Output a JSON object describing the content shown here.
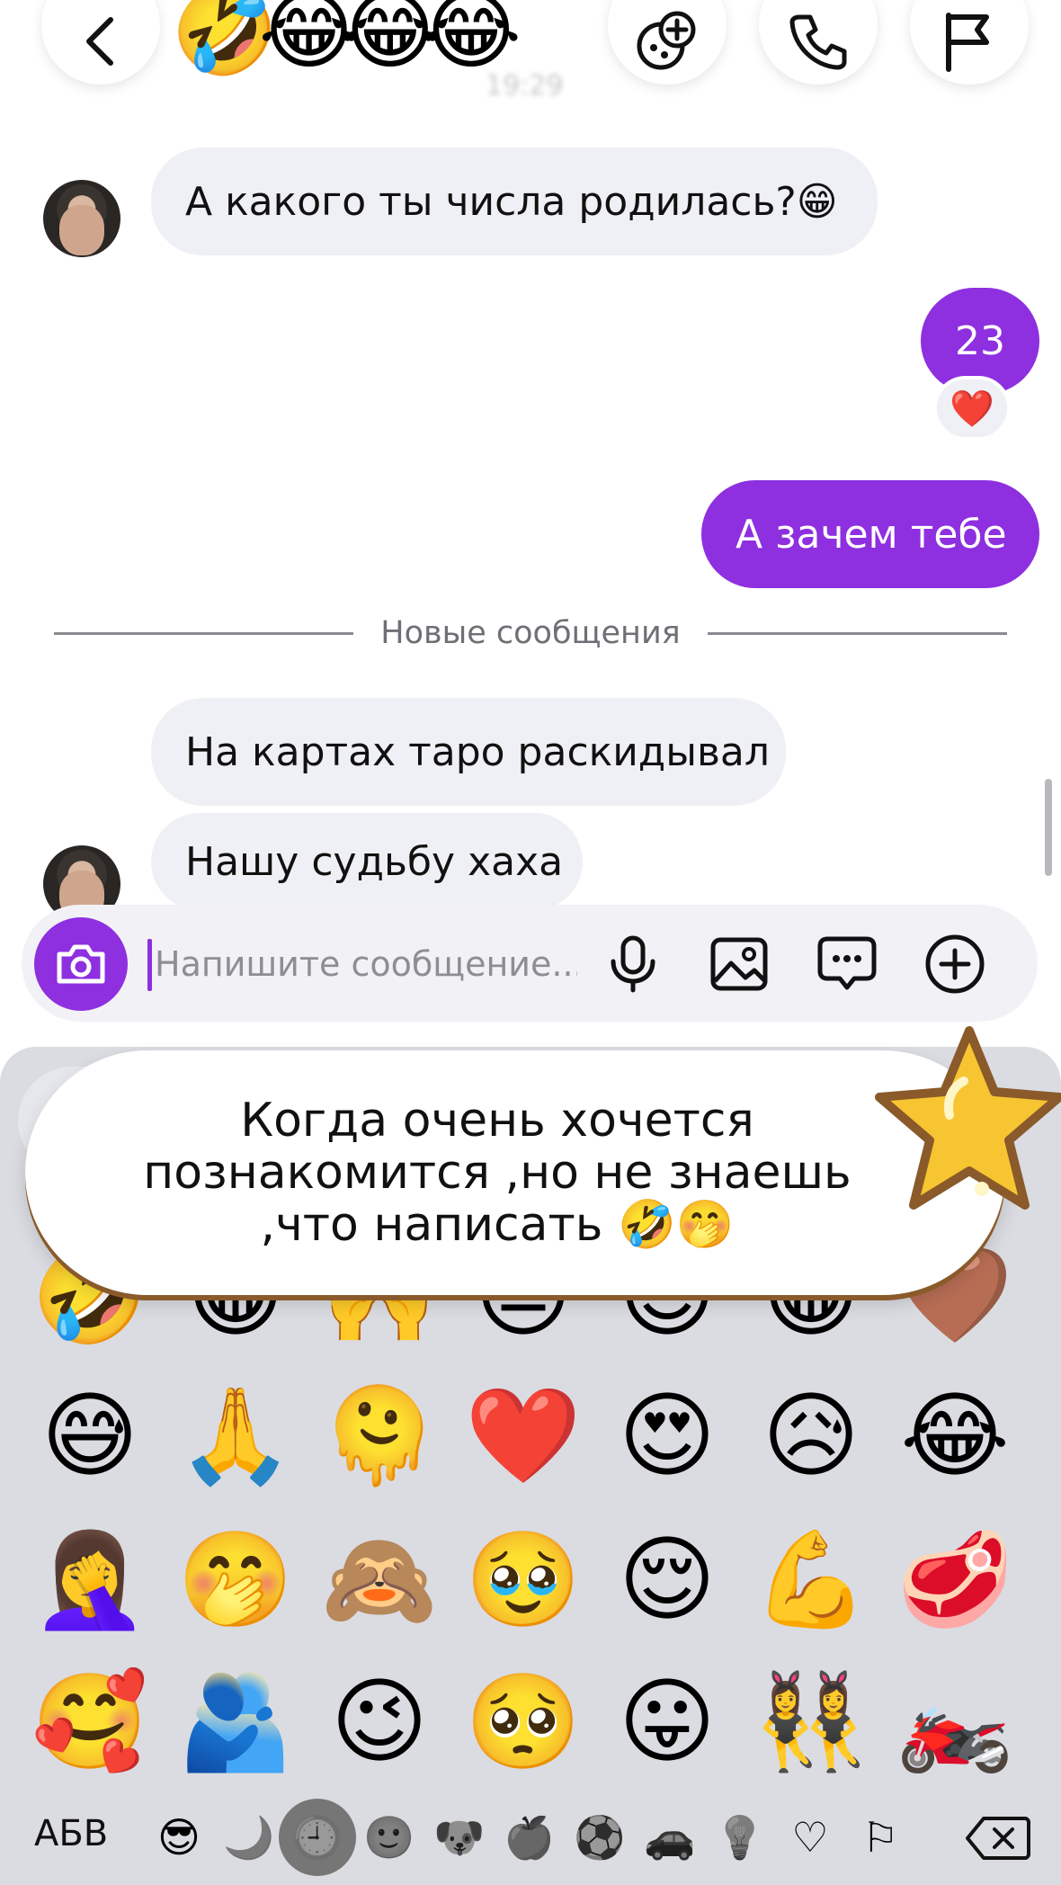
{
  "header": {
    "title_emojis": "🤣😂😂😂",
    "time": "19:29"
  },
  "messages": [
    {
      "dir": "in",
      "text": "А какого ты числа родилась?😁"
    },
    {
      "dir": "out",
      "text": "23",
      "reaction": "❤️"
    },
    {
      "dir": "out",
      "text": "А зачем тебе"
    },
    {
      "dir": "in",
      "text": "На картах таро раскидывал"
    },
    {
      "dir": "in",
      "text": "Нашу судьбу хаха"
    }
  ],
  "divider": {
    "label": "Новые сообщения"
  },
  "composer": {
    "placeholder": "Напишите сообщение..."
  },
  "sticker": {
    "text": "Когда очень хочется познакомится ,но не знаешь ,что написать 🤣🤭"
  },
  "emoji_rows": [
    [
      "🤣",
      "😁",
      "🙌",
      "😑",
      "😊",
      "😁",
      "🤎"
    ],
    [
      "😅",
      "🙏",
      "🫠",
      "❤️",
      "😍",
      "😥",
      "😂"
    ],
    [
      "🤦‍♀️",
      "🤭",
      "🙈",
      "🥹",
      "😌",
      "💪",
      "🥩"
    ],
    [
      "🥰",
      "🫂",
      "😉",
      "🥺",
      "😛",
      "👯‍♀️",
      "🏍️"
    ]
  ],
  "keyboard": {
    "abc_label": "АБВ",
    "categories": [
      "😎",
      "🌙",
      "🕘",
      "🙂",
      "🐶",
      "🍏",
      "⚽",
      "🚗",
      "💡",
      "♡",
      "⚐"
    ]
  },
  "colors": {
    "accent": "#8e2fe0",
    "bubble_in": "#eff0f5",
    "keyboard_bg": "#dadce2"
  }
}
